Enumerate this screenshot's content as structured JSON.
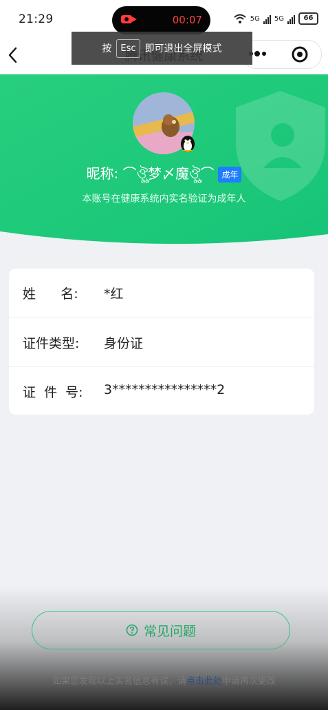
{
  "status_bar": {
    "time": "21:29",
    "recording_time": "00:07",
    "network_1": "5G",
    "network_2": "5G",
    "battery": "66"
  },
  "nav": {
    "title": "腾讯健康系统",
    "esc_prefix": "按",
    "esc_key": "Esc",
    "esc_suffix": "即可退出全屏模式"
  },
  "profile": {
    "nickname": "昵称: ⌒ঔৣ梦〆魔ঔৣ⌒",
    "badge": "成年",
    "subtitle": "本账号在健康系统内实名验证为成年人"
  },
  "info": [
    {
      "label": "姓      名:",
      "value": "*红"
    },
    {
      "label": "证件类型:",
      "value": "身份证"
    },
    {
      "label": "证  件  号:",
      "value": "3****************2"
    }
  ],
  "faq": {
    "label": "常见问题"
  },
  "footer": {
    "prefix": "如果您发现以上实名信息有误，请",
    "link": "点击此处",
    "suffix": "申请再次更改"
  },
  "colors": {
    "hero_green": "#1fc77a",
    "accent": "#20a766",
    "badge_blue": "#1f7dff",
    "background": "#eff1f5"
  }
}
